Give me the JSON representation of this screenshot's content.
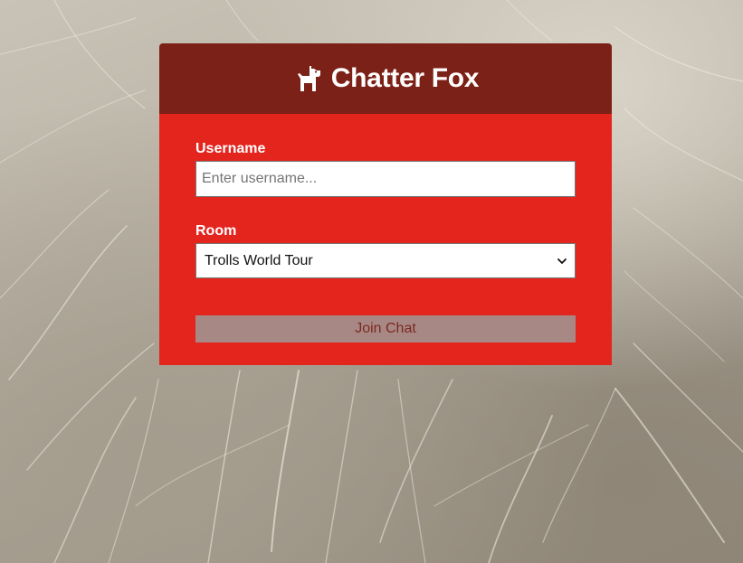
{
  "app": {
    "title": "Chatter Fox",
    "icon": "dog-icon"
  },
  "form": {
    "username": {
      "label": "Username",
      "value": "",
      "placeholder": "Enter username..."
    },
    "room": {
      "label": "Room",
      "selected": "Trolls World Tour"
    },
    "submit_label": "Join Chat"
  },
  "colors": {
    "header_bg": "#7c2117",
    "body_bg": "#e3251e",
    "button_bg": "#a88885",
    "button_text": "#7a2a22"
  }
}
